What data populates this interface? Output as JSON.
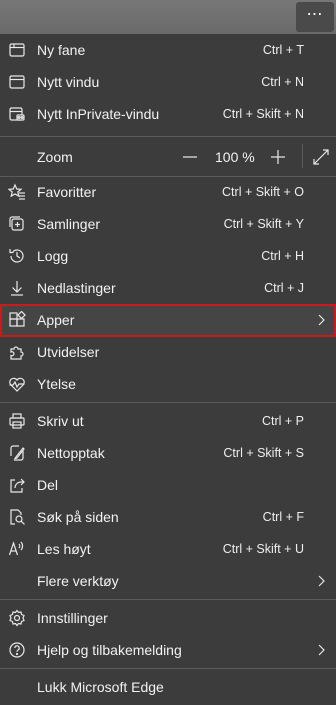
{
  "topbar": {
    "more_icon": "more-horizontal-icon"
  },
  "menu": {
    "new_tab": {
      "label": "Ny fane",
      "shortcut": "Ctrl + T",
      "icon": "new-tab-icon"
    },
    "new_window": {
      "label": "Nytt vindu",
      "shortcut": "Ctrl + N",
      "icon": "new-window-icon"
    },
    "new_inprivate": {
      "label": "Nytt InPrivate-vindu",
      "shortcut": "Ctrl + Skift + N",
      "icon": "inprivate-icon"
    },
    "zoom": {
      "label": "Zoom",
      "value": "100 %"
    },
    "favorites": {
      "label": "Favoritter",
      "shortcut": "Ctrl + Skift + O",
      "icon": "favorites-icon"
    },
    "collections": {
      "label": "Samlinger",
      "shortcut": "Ctrl + Skift + Y",
      "icon": "collections-icon"
    },
    "history": {
      "label": "Logg",
      "shortcut": "Ctrl + H",
      "icon": "history-icon"
    },
    "downloads": {
      "label": "Nedlastinger",
      "shortcut": "Ctrl + J",
      "icon": "download-icon"
    },
    "apps": {
      "label": "Apper",
      "icon": "apps-icon"
    },
    "extensions": {
      "label": "Utvidelser",
      "icon": "extensions-icon"
    },
    "performance": {
      "label": "Ytelse",
      "icon": "performance-icon"
    },
    "print": {
      "label": "Skriv ut",
      "shortcut": "Ctrl + P",
      "icon": "print-icon"
    },
    "web_capture": {
      "label": "Nettopptak",
      "shortcut": "Ctrl + Skift + S",
      "icon": "web-capture-icon"
    },
    "share": {
      "label": "Del",
      "icon": "share-icon"
    },
    "find": {
      "label": "Søk på siden",
      "shortcut": "Ctrl + F",
      "icon": "find-icon"
    },
    "read_aloud": {
      "label": "Les høyt",
      "shortcut": "Ctrl + Skift + U",
      "icon": "read-aloud-icon"
    },
    "more_tools": {
      "label": "Flere verktøy"
    },
    "settings": {
      "label": "Innstillinger",
      "icon": "settings-icon"
    },
    "help": {
      "label": "Hjelp og tilbakemelding",
      "icon": "help-icon"
    },
    "close": {
      "label": "Lukk Microsoft Edge"
    }
  },
  "colors": {
    "highlight_border": "#c81b1b",
    "menu_bg": "#3c3c3c"
  }
}
